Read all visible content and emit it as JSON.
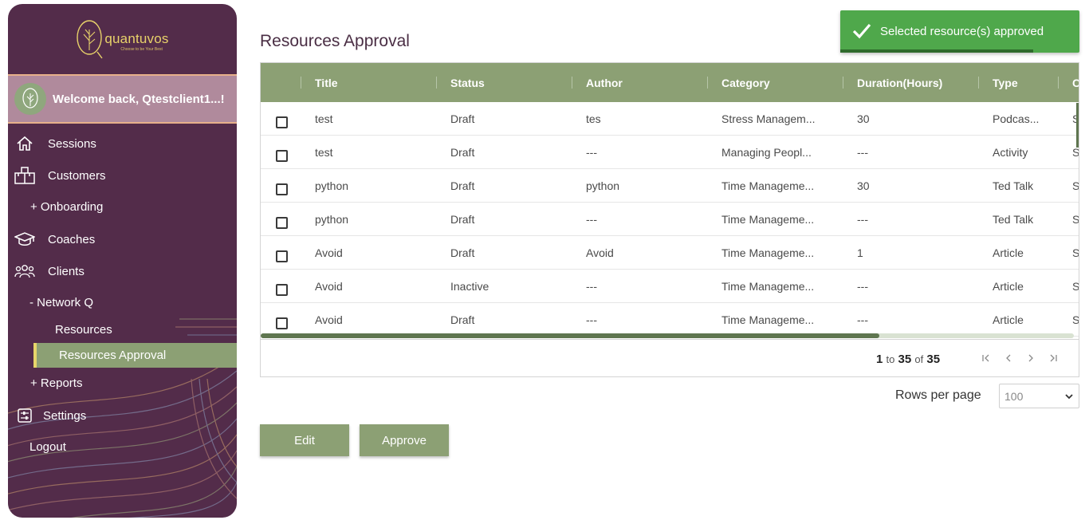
{
  "app": {
    "logo_text": "quantuvos",
    "logo_tagline": "Choose to be Your Best",
    "welcome": "Welcome back, Qtestclient1...!"
  },
  "sidebar": {
    "items": [
      {
        "label": "Sessions",
        "icon": "home-icon"
      },
      {
        "label": "Customers",
        "icon": "boxes-icon"
      },
      {
        "label": "+ Onboarding"
      },
      {
        "label": "Coaches",
        "icon": "graduation-cap-icon"
      },
      {
        "label": "Clients",
        "icon": "users-icon"
      },
      {
        "label": "- Network Q"
      },
      {
        "label": "Resources"
      },
      {
        "label": "Resources Approval",
        "active": true
      },
      {
        "label": "+ Reports"
      },
      {
        "label": "Settings",
        "icon": "settings-icon"
      },
      {
        "label": "Logout"
      }
    ]
  },
  "main": {
    "title": "Resources Approval",
    "columns": [
      "Title",
      "Status",
      "Author",
      "Category",
      "Duration(Hours)",
      "Type",
      "C"
    ],
    "rows": [
      {
        "title": "test",
        "status": "Draft",
        "author": "tes",
        "category": "Stress Managem...",
        "duration": "30",
        "type": "Podcas...",
        "extra": "S"
      },
      {
        "title": "test",
        "status": "Draft",
        "author": "---",
        "category": "Managing Peopl...",
        "duration": "---",
        "type": "Activity",
        "extra": "S"
      },
      {
        "title": "python",
        "status": "Draft",
        "author": "python",
        "category": "Time Manageme...",
        "duration": "30",
        "type": "Ted Talk",
        "extra": "S"
      },
      {
        "title": "python",
        "status": "Draft",
        "author": "---",
        "category": "Time Manageme...",
        "duration": "---",
        "type": "Ted Talk",
        "extra": "S"
      },
      {
        "title": "Avoid",
        "status": "Draft",
        "author": "Avoid",
        "category": "Time Manageme...",
        "duration": "1",
        "type": "Article",
        "extra": "S"
      },
      {
        "title": "Avoid",
        "status": "Inactive",
        "author": "---",
        "category": "Time Manageme...",
        "duration": "---",
        "type": "Article",
        "extra": "S"
      },
      {
        "title": "Avoid",
        "status": "Draft",
        "author": "---",
        "category": "Time Manageme...",
        "duration": "---",
        "type": "Article",
        "extra": "S"
      }
    ],
    "pager": {
      "from": "1",
      "to_word": "to",
      "to": "35",
      "of_word": "of",
      "total": "35"
    },
    "rows_per_page_label": "Rows per page",
    "rows_per_page_value": "100",
    "edit_label": "Edit",
    "approve_label": "Approve"
  },
  "toast": {
    "message": "Selected resource(s) approved"
  },
  "colors": {
    "sidebar_bg": "#532c4a",
    "accent_green": "#8ca074",
    "toast_green": "#4fa84b",
    "logo_gold": "#e8d26a"
  }
}
